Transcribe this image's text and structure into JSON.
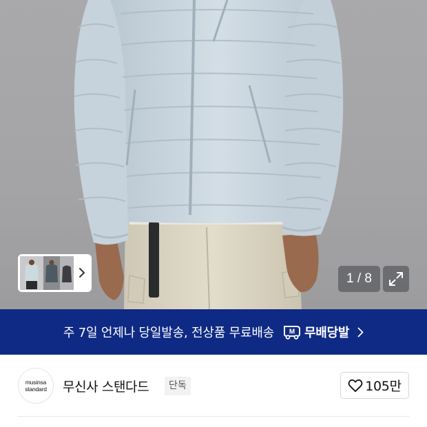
{
  "gallery": {
    "counter_text": "1 / 8",
    "current_index": 1,
    "total_images": 8,
    "colors": {
      "background": "#a6a6a8",
      "jacket": "#c9d6df",
      "pants": "#ddd6c3"
    }
  },
  "thumbnail_strip": {
    "thumbnail_count": 3,
    "next_icon": "chevron-right-icon"
  },
  "expand_icon": "expand-arrows-icon",
  "delivery_banner": {
    "message": "주 7일 언제나 당일발송, 전상품 무료배송",
    "badge_logo": "M",
    "badge_label": "무배당발",
    "background_color": "#0f2a85",
    "icon": "chevron-right-icon"
  },
  "brand": {
    "logo_line1": "musinsa",
    "logo_line2": "standard",
    "name": "무신사 스탠다드",
    "tag": "단독"
  },
  "like": {
    "icon": "heart-outline-icon",
    "count": "105만"
  }
}
